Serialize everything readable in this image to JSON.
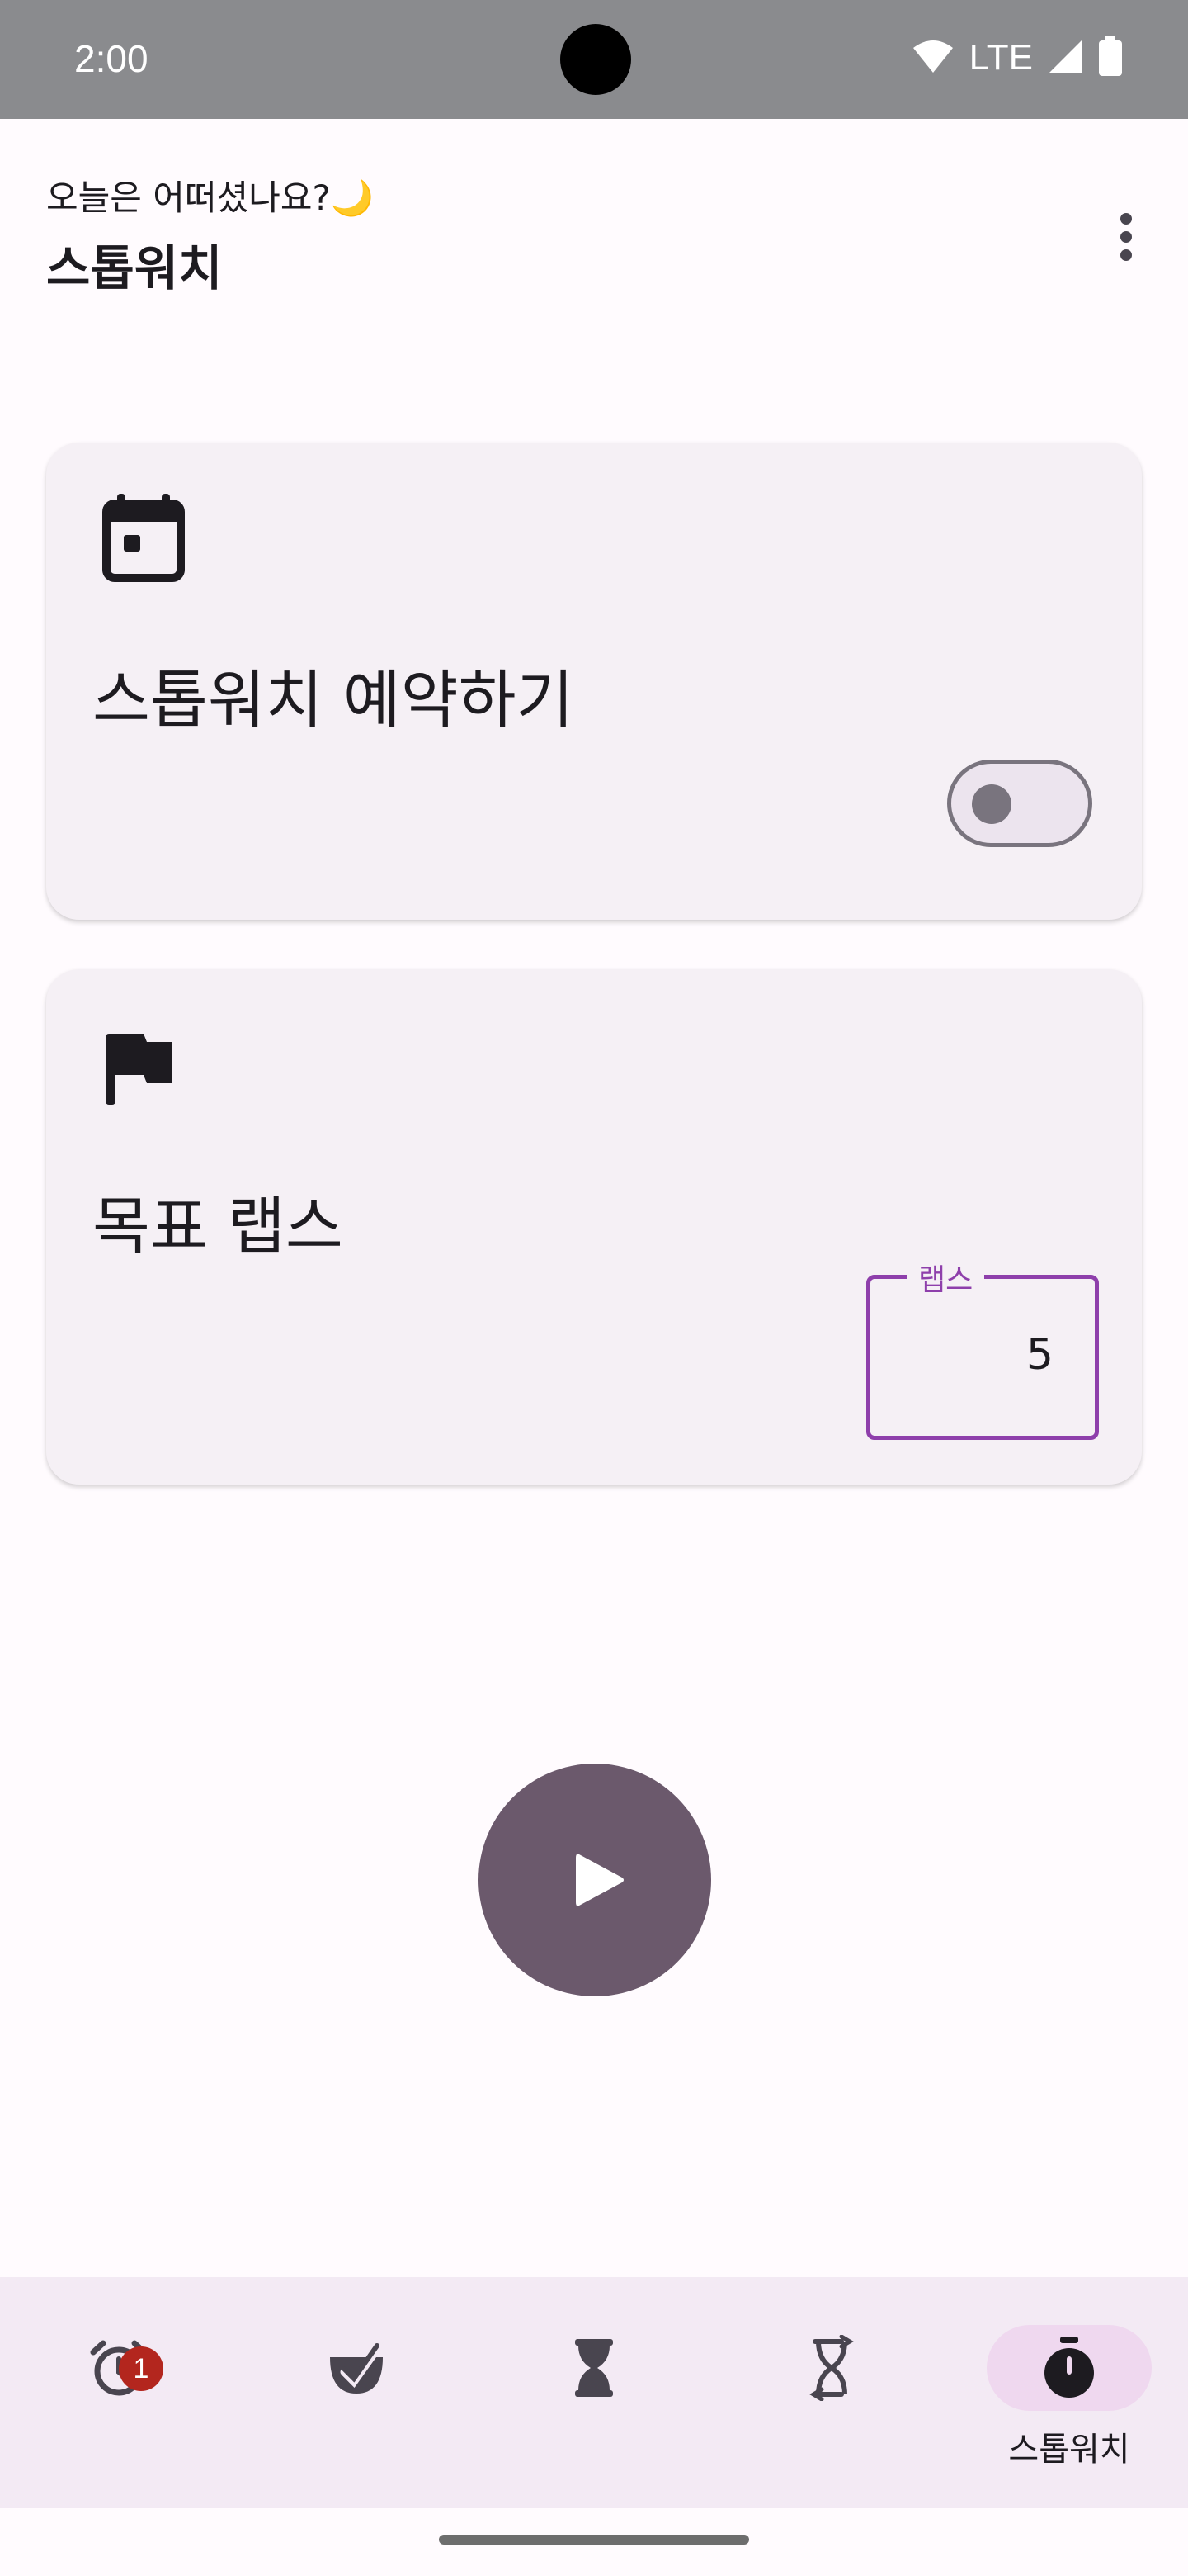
{
  "status_bar": {
    "time": "2:00",
    "network": "LTE"
  },
  "header": {
    "greeting": "오늘은 어떠셨나요?🌙",
    "title": "스톱워치"
  },
  "cards": {
    "schedule": {
      "title": "스톱워치 예약하기",
      "toggle_on": false
    },
    "laps": {
      "title": "목표 랩스",
      "field_label": "랩스",
      "field_value": "5"
    }
  },
  "bottom_nav": {
    "items": [
      {
        "icon": "alarm-icon",
        "badge": "1",
        "label": ""
      },
      {
        "icon": "task-check-icon",
        "label": ""
      },
      {
        "icon": "hourglass-icon",
        "label": ""
      },
      {
        "icon": "hourglass-repeat-icon",
        "label": ""
      },
      {
        "icon": "stopwatch-icon",
        "label": "스톱워치",
        "active": true
      }
    ]
  },
  "colors": {
    "accent": "#8e3fab",
    "play_button": "#6b596c",
    "card_bg": "#f5f0f5",
    "nav_bg": "#f3eaf4",
    "badge": "#b3261e"
  }
}
